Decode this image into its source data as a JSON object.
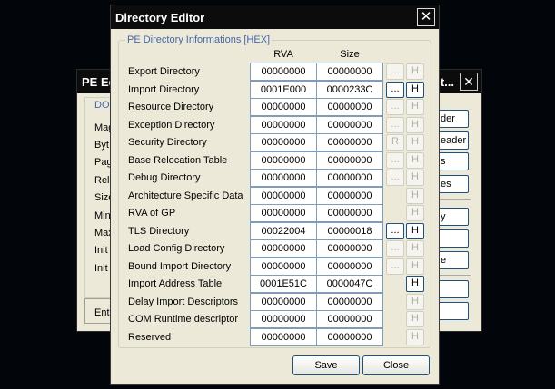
{
  "background_window": {
    "title": "PE Ed",
    "title_tail": "t...",
    "close_glyph": "✕",
    "group_label": "DO",
    "fields": [
      "Mag",
      "Byt",
      "Pag",
      "Relo",
      "Size",
      "Min",
      "Max",
      "Init",
      "Init"
    ],
    "bottom_text": "Ent",
    "buttons": [
      "der",
      "eader",
      "s",
      "es",
      "y",
      "",
      "e",
      "",
      ""
    ]
  },
  "dialog": {
    "title": "Directory Editor",
    "close_glyph": "✕",
    "group_label": "PE Directory Informations [HEX]",
    "columns": {
      "rva": "RVA",
      "size": "Size"
    },
    "rows": [
      {
        "name": "Export Directory",
        "rva": "00000000",
        "size": "00000000",
        "b1": "...",
        "b1_enabled": false,
        "b2": "H",
        "b2_enabled": false
      },
      {
        "name": "Import Directory",
        "rva": "0001E000",
        "size": "0000233C",
        "b1": "...",
        "b1_enabled": true,
        "b2": "H",
        "b2_enabled": true
      },
      {
        "name": "Resource Directory",
        "rva": "00000000",
        "size": "00000000",
        "b1": "...",
        "b1_enabled": false,
        "b2": "H",
        "b2_enabled": false
      },
      {
        "name": "Exception Directory",
        "rva": "00000000",
        "size": "00000000",
        "b1": "...",
        "b1_enabled": false,
        "b2": "H",
        "b2_enabled": false
      },
      {
        "name": "Security Directory",
        "rva": "00000000",
        "size": "00000000",
        "b1": "R",
        "b1_enabled": false,
        "b2": "H",
        "b2_enabled": false
      },
      {
        "name": "Base Relocation Table",
        "rva": "00000000",
        "size": "00000000",
        "b1": "...",
        "b1_enabled": false,
        "b2": "H",
        "b2_enabled": false
      },
      {
        "name": "Debug Directory",
        "rva": "00000000",
        "size": "00000000",
        "b1": "...",
        "b1_enabled": false,
        "b2": "H",
        "b2_enabled": false
      },
      {
        "name": "Architecture Specific Data",
        "rva": "00000000",
        "size": "00000000",
        "b1": null,
        "b1_enabled": false,
        "b2": "H",
        "b2_enabled": false
      },
      {
        "name": "RVA of GP",
        "rva": "00000000",
        "size": "00000000",
        "b1": null,
        "b1_enabled": false,
        "b2": "H",
        "b2_enabled": false
      },
      {
        "name": "TLS Directory",
        "rva": "00022004",
        "size": "00000018",
        "b1": "...",
        "b1_enabled": true,
        "b2": "H",
        "b2_enabled": true
      },
      {
        "name": "Load Config Directory",
        "rva": "00000000",
        "size": "00000000",
        "b1": "...",
        "b1_enabled": false,
        "b2": "H",
        "b2_enabled": false
      },
      {
        "name": "Bound Import Directory",
        "rva": "00000000",
        "size": "00000000",
        "b1": "...",
        "b1_enabled": false,
        "b2": "H",
        "b2_enabled": false
      },
      {
        "name": "Import Address Table",
        "rva": "0001E51C",
        "size": "0000047C",
        "b1": null,
        "b1_enabled": false,
        "b2": "H",
        "b2_enabled": true
      },
      {
        "name": "Delay Import Descriptors",
        "rva": "00000000",
        "size": "00000000",
        "b1": null,
        "b1_enabled": false,
        "b2": "H",
        "b2_enabled": false
      },
      {
        "name": "COM Runtime descriptor",
        "rva": "00000000",
        "size": "00000000",
        "b1": null,
        "b1_enabled": false,
        "b2": "H",
        "b2_enabled": false
      },
      {
        "name": "Reserved",
        "rva": "00000000",
        "size": "00000000",
        "b1": null,
        "b1_enabled": false,
        "b2": "H",
        "b2_enabled": false
      }
    ],
    "buttons": {
      "save": "Save",
      "close": "Close"
    }
  }
}
